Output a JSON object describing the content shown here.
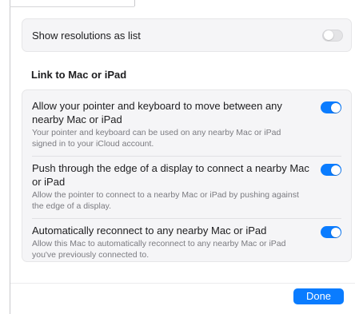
{
  "display_settings": {
    "show_resolutions": {
      "label": "Show resolutions as list",
      "enabled": false
    }
  },
  "link_section": {
    "heading": "Link to Mac or iPad",
    "settings": [
      {
        "title": "Allow your pointer and keyboard to move between any nearby Mac or iPad",
        "description": "Your pointer and keyboard can be used on any nearby Mac or iPad signed in to your iCloud account.",
        "enabled": true
      },
      {
        "title": "Push through the edge of a display to connect a nearby Mac or iPad",
        "description": "Allow the pointer to connect to a nearby Mac or iPad by pushing against the edge of a display.",
        "enabled": true
      },
      {
        "title": "Automatically reconnect to any nearby Mac or iPad",
        "description": "Allow this Mac to automatically reconnect to any nearby Mac or iPad you've previously connected to.",
        "enabled": true
      }
    ]
  },
  "footer": {
    "done_label": "Done"
  },
  "colors": {
    "accent": "#0a7cff",
    "toggle_off": "#e4e4e6",
    "card_bg": "#f5f5f7",
    "secondary_text": "#7b7b80"
  }
}
